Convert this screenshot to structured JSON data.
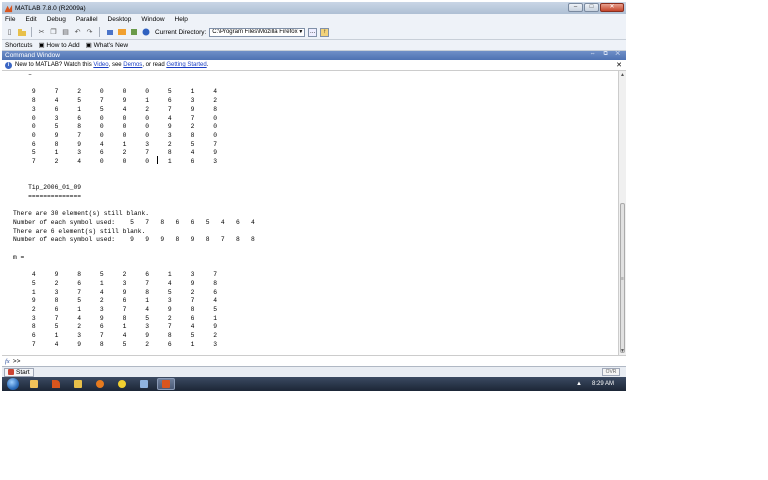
{
  "window": {
    "title": "MATLAB 7.8.0 (R2009a)"
  },
  "menu": [
    "File",
    "Edit",
    "Debug",
    "Parallel",
    "Desktop",
    "Window",
    "Help"
  ],
  "toolbar": {
    "current_dir_label": "Current Directory:",
    "current_dir_value": "C:\\Program Files\\Mozilla Firefox"
  },
  "shortcuts": {
    "label": "Shortcuts",
    "how_to_add": "How to Add",
    "whats_new": "What's New"
  },
  "command_window": {
    "title": "Command Window",
    "info_prefix": "New to MATLAB? Watch this ",
    "info_video": "Video",
    "info_mid1": ", see ",
    "info_demos": "Demos",
    "info_mid2": ", or read ",
    "info_getting_started": "Getting Started",
    "info_suffix": ".",
    "output": "    –\n\n     9     7     2     0     0     0     5     1     4\n     8     4     5     7     9     1     6     3     2\n     3     6     1     5     4     2     7     9     8\n     0     3     6     0     0     0     4     7     0\n     0     5     8     0     0     0     9     2     0\n     0     9     7     0     0     0     3     8     0\n     6     8     9     4     1     3     2     5     7\n     5     1     3     6     2     7     8     4     9\n     7     2     4     0     0     0     1     6     3\n\n\n    Tip_2006_01_09\n    ==============\n\nThere are 30 element(s) still blank.\nNumber of each symbol used:    5   7   8   6   6   5   4   6   4\nThere are 6 element(s) still blank.\nNumber of each symbol used:    9   9   9   8   9   8   7   8   8\n\nm =\n\n     4     9     8     5     2     6     1     3     7\n     5     2     6     1     3     7     4     9     8\n     1     3     7     4     9     8     5     2     6\n     9     8     5     2     6     1     3     7     4\n     2     6     1     3     7     4     9     8     5\n     3     7     4     9     8     5     2     6     1\n     8     5     2     6     1     3     7     4     9\n     6     1     3     7     4     9     8     5     2\n     7     4     9     8     5     2     6     1     3",
    "prompt": ">>"
  },
  "status": {
    "start": "Start",
    "ovr": "OVR"
  },
  "taskbar": {
    "clock": "8:29 AM"
  }
}
